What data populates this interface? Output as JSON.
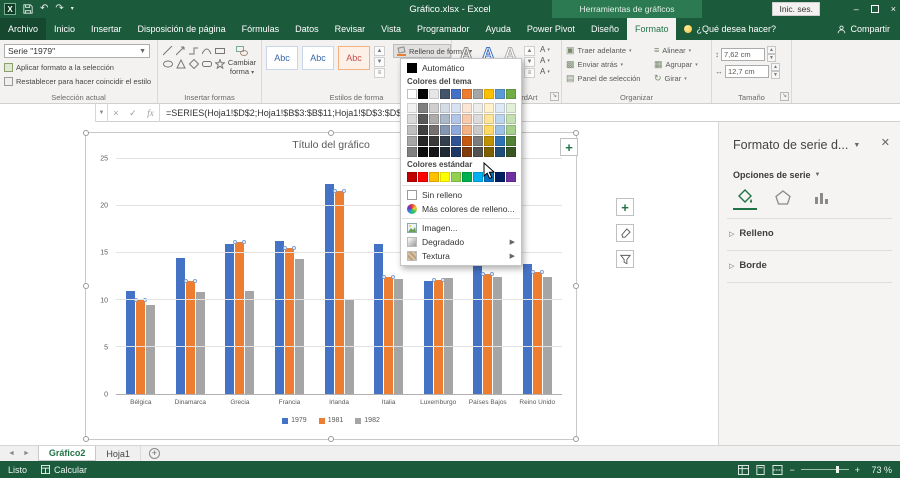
{
  "titlebar": {
    "title": "Gráfico.xlsx - Excel",
    "context_group": "Herramientas de gráficos",
    "sign_in": "Inic. ses."
  },
  "tabs": {
    "items": [
      "Archivo",
      "Inicio",
      "Insertar",
      "Disposición de página",
      "Fórmulas",
      "Datos",
      "Revisar",
      "Vista",
      "Programador",
      "Ayuda",
      "Power Pivot",
      "Diseño",
      "Formato"
    ],
    "active": "Formato",
    "tell_me": "¿Qué desea hacer?",
    "share": "Compartir"
  },
  "ribbon": {
    "seleccion": {
      "label": "Selección actual",
      "combo": "Serie \"1979\"",
      "apply": "Aplicar formato a la selección",
      "reset": "Restablecer para hacer coincidir el estilo"
    },
    "formas": {
      "label": "Insertar formas",
      "cambiar": "Cambiar forma"
    },
    "estilos": {
      "label": "Estilos de forma",
      "abc": "Abc",
      "relleno": "Relleno de forma"
    },
    "wordart": {
      "label": "Estilos de WordArt",
      "a": "A"
    },
    "organizar": {
      "label": "Organizar",
      "items": [
        "Traer adelante",
        "Enviar atrás",
        "Panel de selección",
        "Alinear",
        "Agrupar",
        "Girar"
      ]
    },
    "tamano": {
      "label": "Tamaño",
      "alto": "7,62 cm",
      "ancho": "12,7 cm"
    }
  },
  "formula_bar": {
    "name_box": "",
    "formula": "=SERIES(Hoja1!$D$2;Hoja1!$B$3:$B$11;Hoja1!$D$3:$D$"
  },
  "fill_menu": {
    "automatico": "Automático",
    "theme_header": "Colores del tema",
    "standard_header": "Colores estándar",
    "sin_relleno": "Sin relleno",
    "mas_colores": "Más colores de relleno...",
    "imagen": "Imagen...",
    "degradado": "Degradado",
    "textura": "Textura",
    "theme_rows": [
      [
        "#FFFFFF",
        "#000000",
        "#E7E6E6",
        "#44546A",
        "#4472C4",
        "#ED7D31",
        "#A5A5A5",
        "#FFC000",
        "#5B9BD5",
        "#70AD47"
      ],
      [
        "#F2F2F2",
        "#808080",
        "#D0CECE",
        "#D6DCE4",
        "#D9E2F3",
        "#FBE5D5",
        "#EDEDED",
        "#FFF2CC",
        "#DEEAF6",
        "#E2EFD9"
      ],
      [
        "#D9D9D9",
        "#595959",
        "#AEABAB",
        "#ACB9CA",
        "#B4C6E7",
        "#F7CAAC",
        "#DBDBDB",
        "#FFE599",
        "#BDD6EE",
        "#C5E0B3"
      ],
      [
        "#BFBFBF",
        "#404040",
        "#757070",
        "#8496B0",
        "#8EAADB",
        "#F4B183",
        "#C9C9C9",
        "#FFD966",
        "#9CC2E5",
        "#A8D08D"
      ],
      [
        "#A6A6A6",
        "#262626",
        "#3A3838",
        "#333F4F",
        "#2F5496",
        "#C45911",
        "#7B7B7B",
        "#BF9000",
        "#2E74B5",
        "#538135"
      ],
      [
        "#808080",
        "#0D0D0D",
        "#161616",
        "#222A35",
        "#1F3864",
        "#823B0B",
        "#525252",
        "#7F6000",
        "#1F4E79",
        "#375623"
      ]
    ],
    "standard_colors": [
      "#C00000",
      "#FF0000",
      "#FFC000",
      "#FFFF00",
      "#92D050",
      "#00B050",
      "#00B0F0",
      "#0070C0",
      "#002060",
      "#7030A0"
    ]
  },
  "chart_data": {
    "type": "bar",
    "title": "Título del gráfico",
    "categories": [
      "Bélgica",
      "Dinamarca",
      "Grecia",
      "Francia",
      "Irlanda",
      "Italia",
      "Luxemburgo",
      "Países Bajos",
      "Reino Unido"
    ],
    "series": [
      {
        "name": "1979",
        "color": "#4472C4",
        "selected": false,
        "values": [
          11,
          14.5,
          16,
          16.3,
          22.3,
          16,
          12,
          14.2,
          13.8
        ]
      },
      {
        "name": "1981",
        "color": "#ED7D31",
        "selected": true,
        "values": [
          10,
          12,
          16.2,
          15.5,
          21.6,
          12.4,
          12.1,
          12.8,
          13
        ]
      },
      {
        "name": "1982",
        "color": "#A5A5A5",
        "selected": false,
        "values": [
          9.5,
          10.8,
          11,
          14.4,
          10,
          12.2,
          12.3,
          12.5,
          12.5
        ]
      }
    ],
    "ylim": [
      0,
      25
    ],
    "yticks": [
      0,
      5,
      10,
      15,
      20,
      25
    ],
    "grid": true,
    "legend_position": "bottom"
  },
  "panel": {
    "title": "Formato de serie d...",
    "options": "Opciones de serie",
    "relleno": "Relleno",
    "borde": "Borde"
  },
  "sheet_tabs": {
    "tabs": [
      "Gráfico2",
      "Hoja1"
    ],
    "active": "Gráfico2"
  },
  "status": {
    "ready": "Listo",
    "calc": "Calcular",
    "zoom": "73 %"
  }
}
